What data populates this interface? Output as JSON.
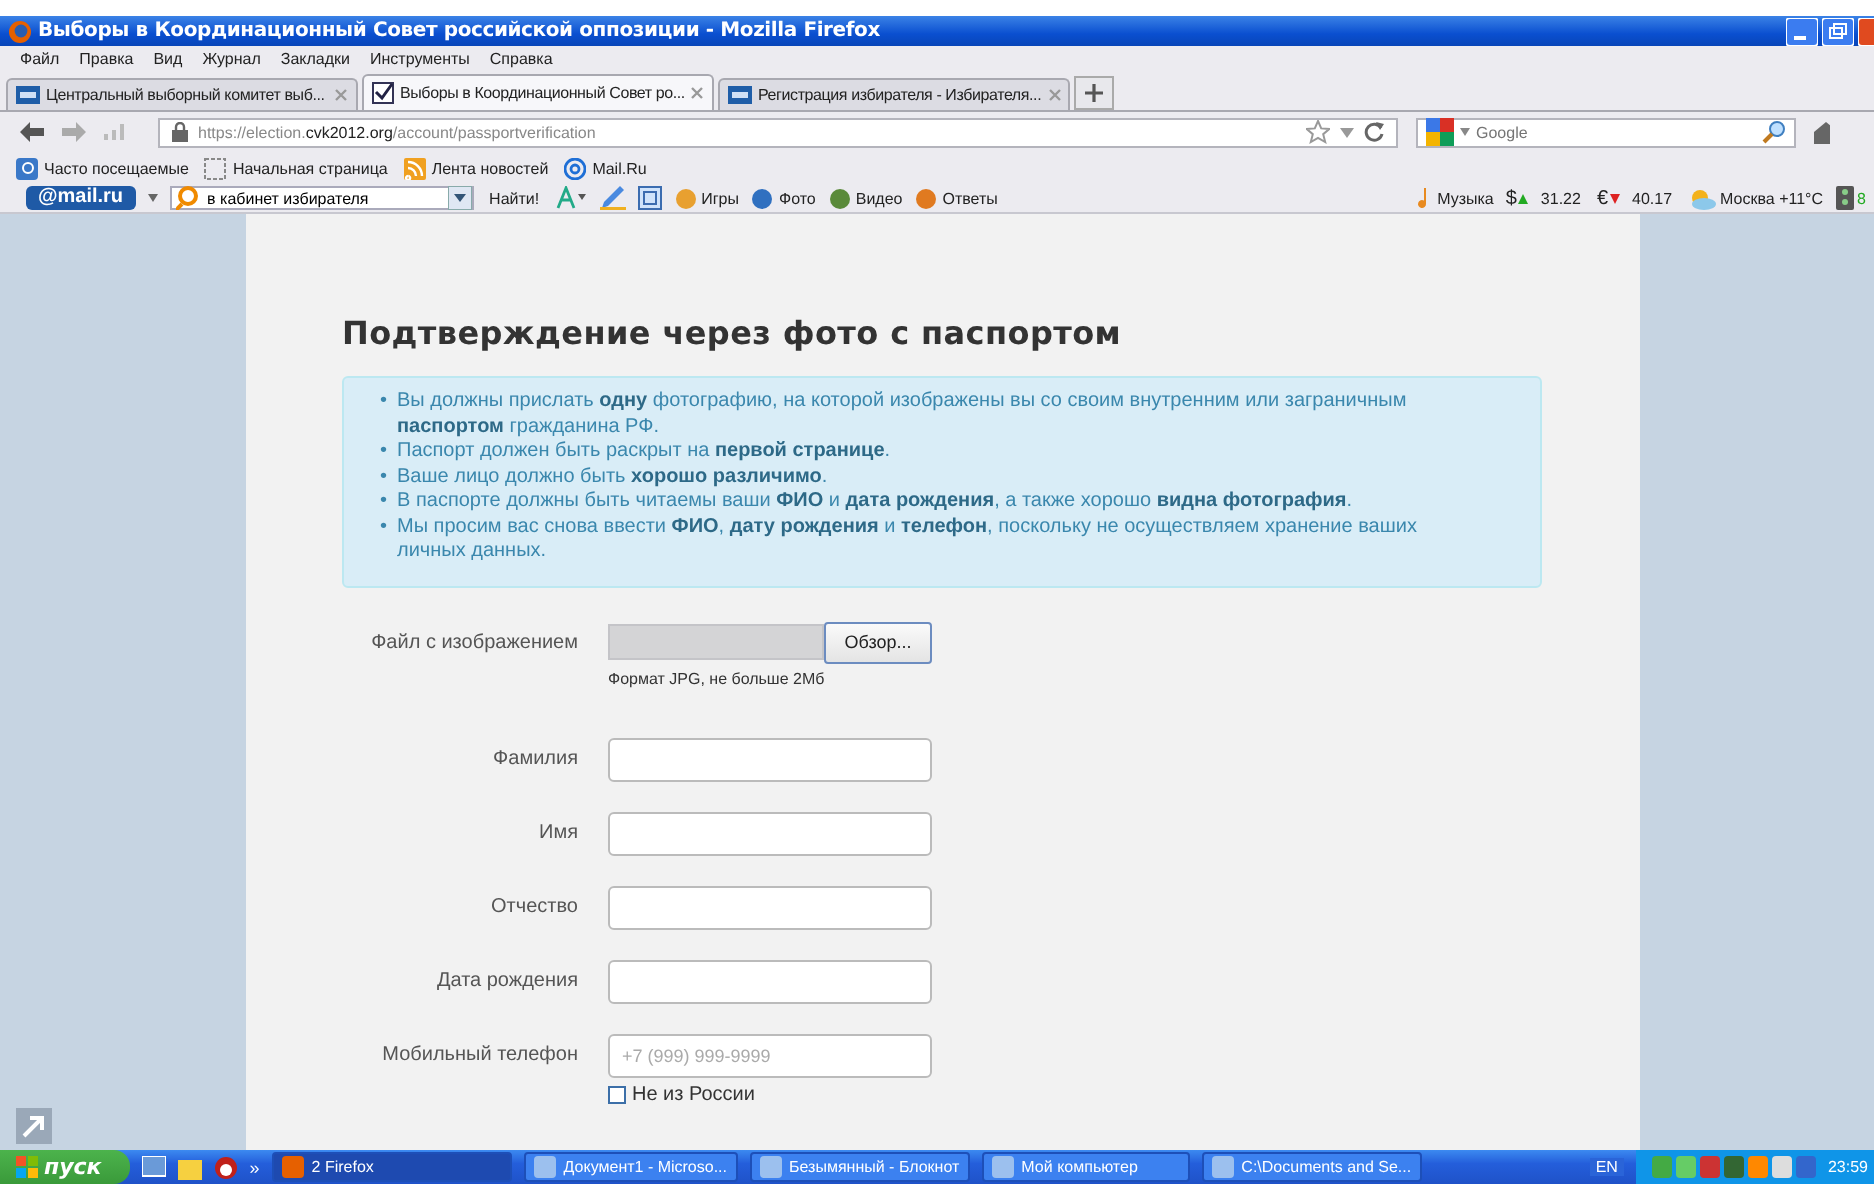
{
  "window": {
    "title": "Выборы в Координационный Совет российской оппозиции - Mozilla Firefox"
  },
  "menu": [
    "Файл",
    "Правка",
    "Вид",
    "Журнал",
    "Закладки",
    "Инструменты",
    "Справка"
  ],
  "tabs": [
    {
      "label": "Центральный выборный комитет выб...",
      "selected": false,
      "kind": "cik"
    },
    {
      "label": "Выборы в Координационный Совет ро...",
      "selected": true,
      "kind": "check"
    },
    {
      "label": "Регистрация избирателя - Избирателя...",
      "selected": false,
      "kind": "cik"
    }
  ],
  "address": {
    "host": "https://election.",
    "domain": "cvk2012.org",
    "path": "/account/passportverification"
  },
  "search": {
    "placeholder": "Google"
  },
  "bookmarks": [
    "Часто посещаемые",
    "Начальная страница",
    "Лента новостей",
    "Mail.Ru"
  ],
  "mail_toolbar": {
    "logo": "@mail.ru",
    "query": "в кабинет избирателя",
    "find": "Найти!",
    "links": [
      "Игры",
      "Фото",
      "Видео",
      "Ответы"
    ],
    "music": "Музыка",
    "usd_sign": "$",
    "usd": "31.22",
    "eur_sign": "€",
    "eur": "40.17",
    "weather": "Москва +11°C",
    "traffic": "8"
  },
  "page": {
    "heading": "Подтверждение через фото с паспортом",
    "bullet": "•",
    "notes": [
      "Вы должны прислать **одну** фотографию, на которой изображены вы со своим внутренним или заграничным **паспортом** гражданина РФ.",
      "Паспорт должен быть раскрыт на **первой странице**.",
      "Ваше лицо должно быть **хорошо различимо**.",
      "В паспорте должны быть читаемы ваши **ФИО** и **дата рождения**, а также хорошо **видна фотография**.",
      "Мы просим вас снова ввести **ФИО**, **дату рождения** и **телефон**, поскольку не осуществляем хранение ваших личных данных."
    ],
    "fields": [
      {
        "kind": "file",
        "label": "Файл с изображением",
        "button": "Обзор...",
        "hint": "Формат JPG, не больше 2Мб"
      },
      {
        "kind": "text",
        "label": "Фамилия"
      },
      {
        "kind": "text",
        "label": "Имя"
      },
      {
        "kind": "text",
        "label": "Отчество"
      },
      {
        "kind": "text",
        "label": "Дата рождения"
      },
      {
        "kind": "phone",
        "label": "Мобильный телефон",
        "placeholder": "+7 (999) 999-9999",
        "checkbox": {
          "label": "Не из России",
          "checked": false
        }
      }
    ]
  },
  "taskbar": {
    "start": "пуск",
    "more": "»",
    "tasks": [
      {
        "label": "2 Firefox",
        "selected": true
      },
      {
        "label": "Документ1 - Microso...",
        "selected": false
      },
      {
        "label": "Безымянный - Блокнот",
        "selected": false
      },
      {
        "label": "Мой компьютер",
        "selected": false
      },
      {
        "label": "C:\\Documents and Se...",
        "selected": false
      }
    ],
    "language": "EN",
    "clock": "23:59"
  }
}
